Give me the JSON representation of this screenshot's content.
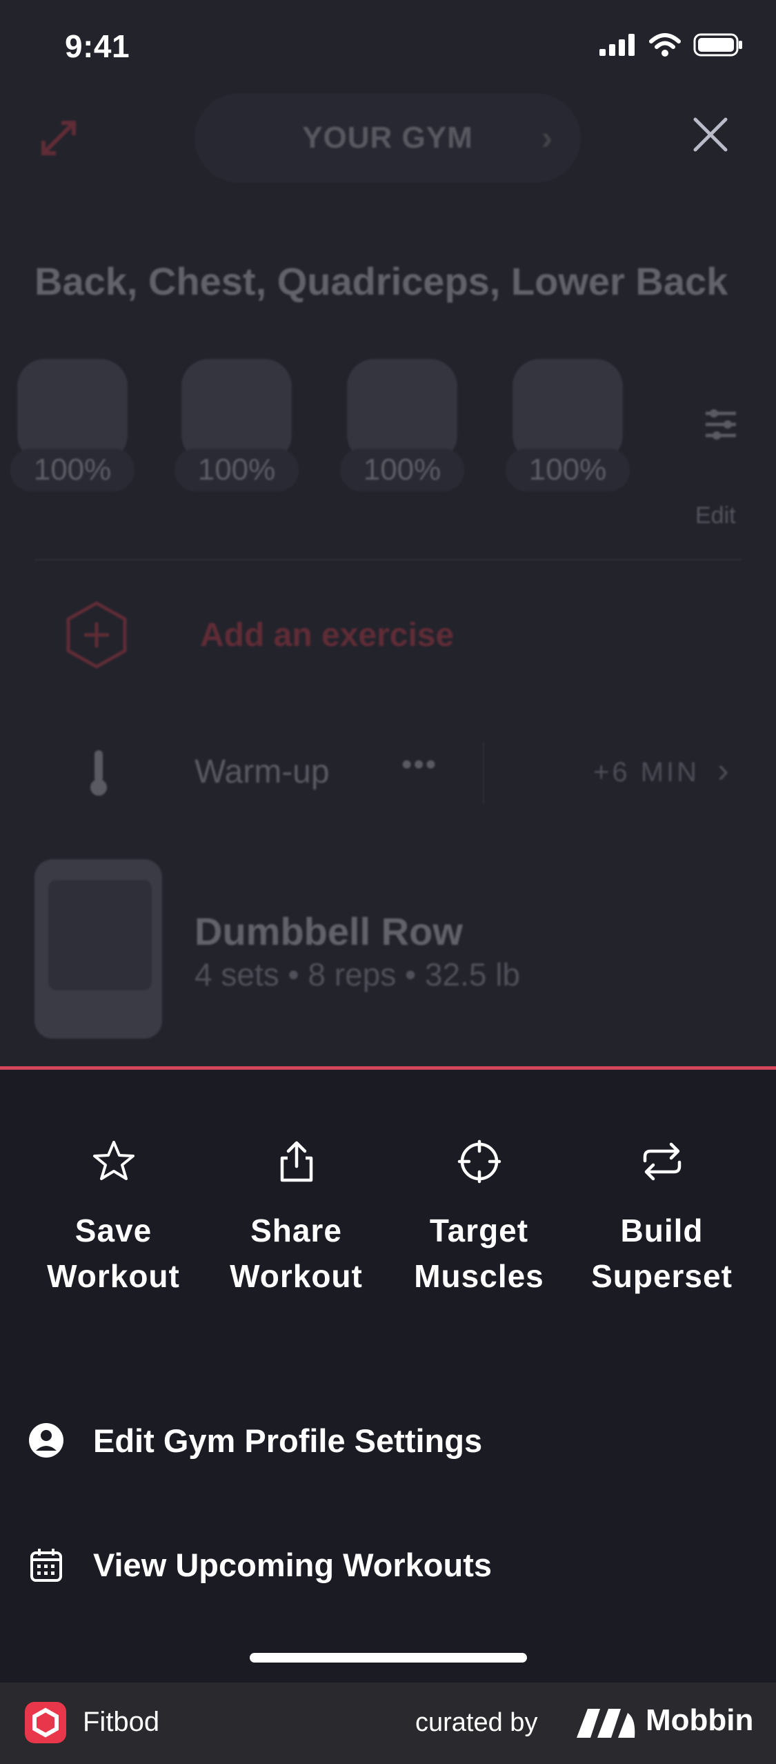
{
  "status_bar": {
    "time": "9:41"
  },
  "background": {
    "gym_selector": "YOUR GYM",
    "muscle_groups_title": "Back, Chest, Quadriceps, Lower Back",
    "muscles": [
      {
        "percent": "100%"
      },
      {
        "percent": "100%"
      },
      {
        "percent": "100%"
      },
      {
        "percent": "100%"
      }
    ],
    "edit_label": "Edit",
    "add_exercise_label": "Add an exercise",
    "warmup": {
      "label": "Warm-up",
      "more": "•••",
      "time": "+6 MIN"
    },
    "exercise": {
      "name": "Dumbbell Row",
      "meta": "4 sets • 8 reps • 32.5 lb"
    }
  },
  "sheet": {
    "accent_color": "#d6465a",
    "actions": [
      {
        "line1": "Save",
        "line2": "Workout",
        "icon": "star-icon"
      },
      {
        "line1": "Share",
        "line2": "Workout",
        "icon": "share-icon"
      },
      {
        "line1": "Target",
        "line2": "Muscles",
        "icon": "target-icon"
      },
      {
        "line1": "Build",
        "line2": "Superset",
        "icon": "repeat-icon"
      }
    ],
    "menu": [
      {
        "label": "Edit Gym Profile Settings",
        "icon": "user-circle-icon"
      },
      {
        "label": "View Upcoming Workouts",
        "icon": "calendar-icon"
      }
    ]
  },
  "footer": {
    "app_name": "Fitbod",
    "curated_by": "curated by",
    "brand": "Mobbin",
    "brand_color": "#e8374a"
  }
}
